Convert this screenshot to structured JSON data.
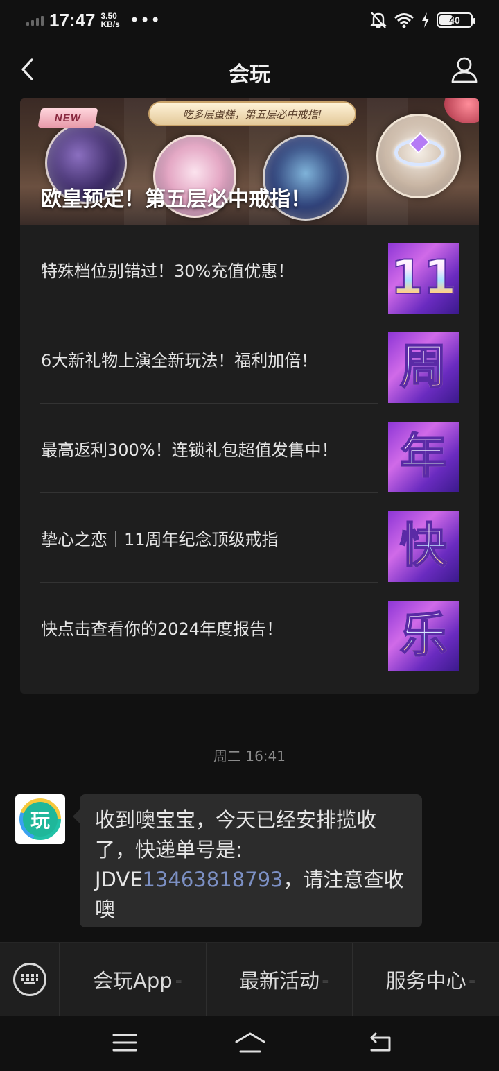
{
  "status_bar": {
    "time": "17:47",
    "net_speed_value": "3.50",
    "net_speed_unit": "KB/s",
    "more_dots": "•••",
    "battery": "40"
  },
  "header": {
    "title": "会玩",
    "back_icon": "chevron-left-icon",
    "profile_icon": "person-icon"
  },
  "news_card": {
    "banner": {
      "new_tag": "NEW",
      "ribbon_text": "吃多层蛋糕，第五层必中戒指!",
      "headline": "欧皇预定！第五层必中戒指！"
    },
    "items": [
      {
        "title": "特殊档位别错过！30%充值优惠！",
        "thumb_text": "11"
      },
      {
        "title": "6大新礼物上演全新玩法！福利加倍！",
        "thumb_text": "周"
      },
      {
        "title": "最高返利300%！连锁礼包超值发售中！",
        "thumb_text": "年"
      },
      {
        "title": "挚心之恋｜11周年纪念顶级戒指",
        "thumb_text": "快"
      },
      {
        "title": "快点击查看你的2024年度报告！",
        "thumb_text": "乐"
      }
    ]
  },
  "conversation": {
    "timestamp": "周二 16:41",
    "avatar_text": "玩",
    "message": {
      "line1": "收到噢宝宝，今天已经安排揽收",
      "line2": "了，快递单号是:",
      "tracking_prefix": "JDVE",
      "tracking_number": "13463818793",
      "line3_suffix": "，请注意查收",
      "line4": "噢"
    }
  },
  "menu": {
    "keyboard_icon": "keyboard-icon",
    "items": [
      {
        "label": "会玩App"
      },
      {
        "label": "最新活动"
      },
      {
        "label": "服务中心"
      }
    ]
  },
  "colors": {
    "background": "#111111",
    "card": "#1e1e1e",
    "bubble": "#2c2c2c",
    "link": "#7c90c4"
  }
}
